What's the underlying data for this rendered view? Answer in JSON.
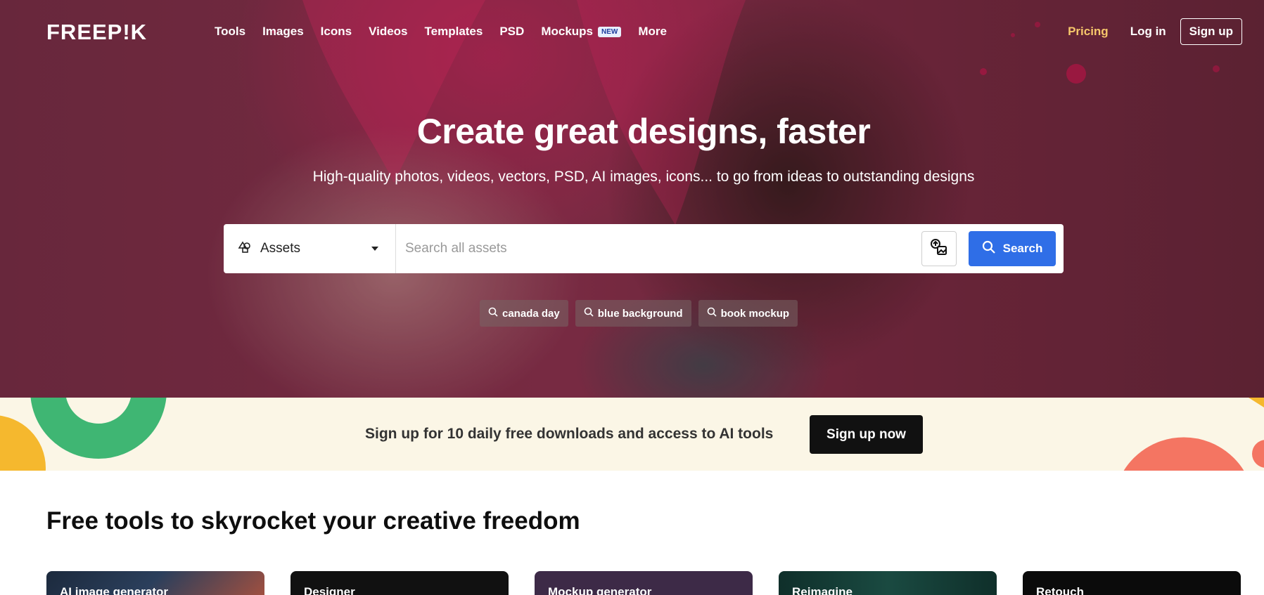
{
  "header": {
    "logo": "FREEP!K",
    "nav": [
      {
        "label": "Tools"
      },
      {
        "label": "Images"
      },
      {
        "label": "Icons"
      },
      {
        "label": "Videos"
      },
      {
        "label": "Templates"
      },
      {
        "label": "PSD"
      },
      {
        "label": "Mockups",
        "badge": "NEW"
      },
      {
        "label": "More"
      }
    ],
    "pricing": "Pricing",
    "login": "Log in",
    "signup": "Sign up"
  },
  "hero": {
    "title": "Create great designs, faster",
    "subtitle": "High-quality photos, videos, vectors, PSD, AI images, icons... to go from ideas to outstanding designs"
  },
  "search": {
    "category": "Assets",
    "placeholder": "Search all assets",
    "value": "",
    "button": "Search"
  },
  "suggestions": [
    {
      "label": "canada day"
    },
    {
      "label": "blue background"
    },
    {
      "label": "book mockup"
    }
  ],
  "promo": {
    "text": "Sign up for 10 daily free downloads and access to AI tools",
    "button": "Sign up now"
  },
  "tools": {
    "title": "Free tools to skyrocket your creative freedom",
    "cards": [
      {
        "label": "AI image generator",
        "color": "#1c2a3d"
      },
      {
        "label": "Designer",
        "color": "#111111"
      },
      {
        "label": "Mockup generator",
        "color": "#3d2a47"
      },
      {
        "label": "Reimagine",
        "color": "#123a32"
      },
      {
        "label": "Retouch",
        "color": "#0b0b0b"
      }
    ]
  },
  "colors": {
    "accent_blue": "#2f6ee7",
    "pricing": "#f6c76b",
    "promo_bg": "#fbf6e6"
  }
}
